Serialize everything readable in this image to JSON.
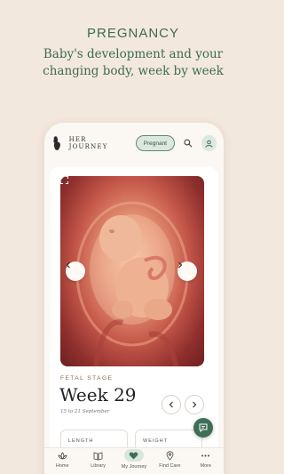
{
  "promo": {
    "title": "PREGNANCY",
    "subtitle_line1": "Baby's development and your",
    "subtitle_line2": "changing body, week by week"
  },
  "app": {
    "brand": "HER JOURNEY",
    "mode_pill": "Pregnant"
  },
  "stage": {
    "label": "FETAL STAGE",
    "week": "Week 29",
    "date_range": "15 to 21 September"
  },
  "metrics": {
    "length_label": "LENGTH",
    "weight_label": "WEIGHT"
  },
  "tabs": [
    {
      "label": "Home",
      "icon": "lotus-icon"
    },
    {
      "label": "Library",
      "icon": "book-icon"
    },
    {
      "label": "My Journey",
      "icon": "heart-icon"
    },
    {
      "label": "Find Care",
      "icon": "location-pin-icon"
    },
    {
      "label": "More",
      "icon": "more-dots-icon"
    }
  ],
  "colors": {
    "accent": "#3e6f54",
    "background": "#f3e8de"
  }
}
